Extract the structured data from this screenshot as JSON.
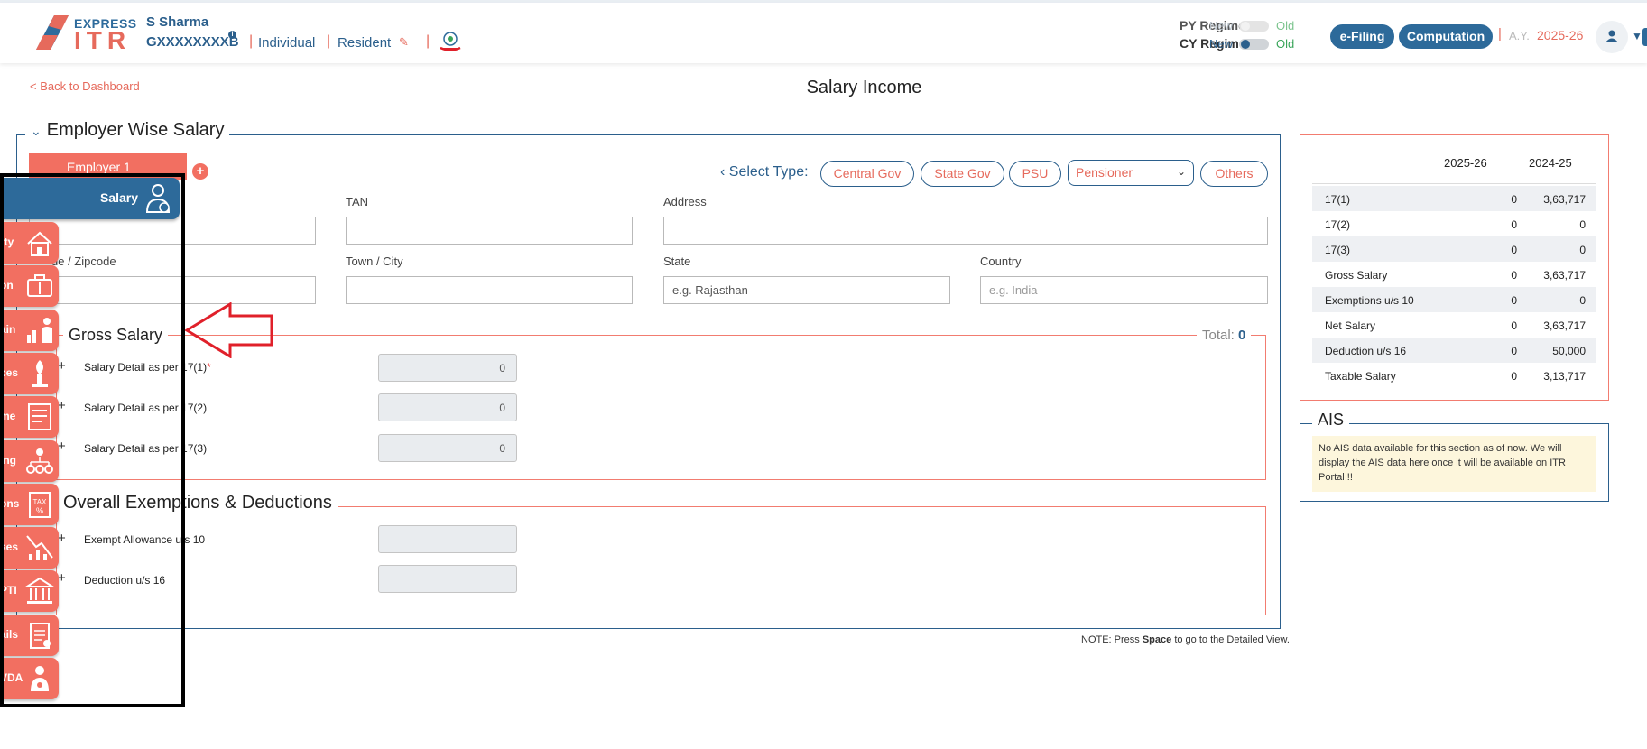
{
  "header": {
    "logo_express": "EXPRESS",
    "logo_itr": "ITR",
    "user_name": "S Sharma",
    "pan": "GXXXXXXXXB",
    "info_icon": "i",
    "status": "Individual",
    "residency": "Resident",
    "separator": "|",
    "regime": {
      "py_label": "PY Regime",
      "cy_label": "CY Regime",
      "new_label": "New",
      "old_label": "Old"
    },
    "efiling_label": "e-Filing",
    "computation_label": "Computation",
    "ay_label": "A.Y.",
    "ay_value": "2025-26"
  },
  "page": {
    "back_link": "< Back to Dashboard",
    "title": "Salary Income"
  },
  "employer_section": {
    "title": "Employer Wise Salary",
    "employer_tab": "Employer 1",
    "select_type_label": "Select Type:",
    "types": [
      "Central Gov",
      "State Gov",
      "PSU",
      "Others"
    ],
    "select_value": "Pensioner",
    "fields": {
      "tan_label": "TAN",
      "address_label": "Address",
      "pincode_label": "de / Zipcode",
      "town_label": "Town / City",
      "state_label": "State",
      "state_placeholder": "e.g. Rajasthan",
      "country_label": "Country",
      "country_placeholder": "e.g. India"
    }
  },
  "gross_salary": {
    "title": "Gross Salary",
    "total_label": "Total:",
    "total_value": "0",
    "rows": [
      {
        "label": "Salary Detail as per 17(1)",
        "required": "*",
        "value": "0"
      },
      {
        "label": "Salary Detail as per 17(2)",
        "value": "0"
      },
      {
        "label": "Salary Detail as per 17(3)",
        "value": "0"
      }
    ]
  },
  "overall": {
    "title": "Overall Exemptions & Deductions",
    "rows": [
      {
        "label": "Exempt Allowance u/s 10",
        "value": ""
      },
      {
        "label": "Deduction u/s 16",
        "value": ""
      }
    ]
  },
  "note": {
    "prefix": "NOTE: Press ",
    "key": "Space",
    "suffix": " to go to the Detailed View."
  },
  "summary": {
    "col1": "2025-26",
    "col2": "2024-25",
    "rows": [
      {
        "label": "17(1)",
        "cy": "0",
        "py": "3,63,717"
      },
      {
        "label": "17(2)",
        "cy": "0",
        "py": "0"
      },
      {
        "label": "17(3)",
        "cy": "0",
        "py": "0"
      },
      {
        "label": "Gross Salary",
        "cy": "0",
        "py": "3,63,717"
      },
      {
        "label": "Exemptions u/s 10",
        "cy": "0",
        "py": "0"
      },
      {
        "label": "Net Salary",
        "cy": "0",
        "py": "3,63,717"
      },
      {
        "label": "Deduction u/s 16",
        "cy": "0",
        "py": "50,000"
      },
      {
        "label": "Taxable Salary",
        "cy": "0",
        "py": "3,13,717"
      }
    ]
  },
  "ais": {
    "title": "AIS",
    "message": "No AIS data available for this section as of now. We will display the AIS data here once it will be available on ITR Portal !!"
  },
  "sidebar": {
    "active": {
      "label": "Salary",
      "icon": "salary-person-icon"
    },
    "items": [
      {
        "label": "rty",
        "icon": "house-property-icon"
      },
      {
        "label": "on",
        "icon": "business-profession-icon"
      },
      {
        "label": "ain",
        "icon": "capital-gain-icon"
      },
      {
        "label": "ces",
        "icon": "other-sources-icon"
      },
      {
        "label": "me",
        "icon": "exempt-income-icon"
      },
      {
        "label": "ing",
        "icon": "clubbing-icon"
      },
      {
        "label": "ons",
        "icon": "deductions-icon"
      },
      {
        "label": "ses",
        "icon": "losses-icon"
      },
      {
        "label": "PTI",
        "icon": "pti-bank-icon"
      },
      {
        "label": "ails",
        "icon": "tax-details-icon"
      },
      {
        "label": "VDA",
        "icon": "vda-icon"
      }
    ]
  },
  "colors": {
    "brand_blue": "#2d6a9a",
    "brand_coral": "#f26f61",
    "success_green": "#3aa55a",
    "annotation_red": "#e0202a"
  }
}
